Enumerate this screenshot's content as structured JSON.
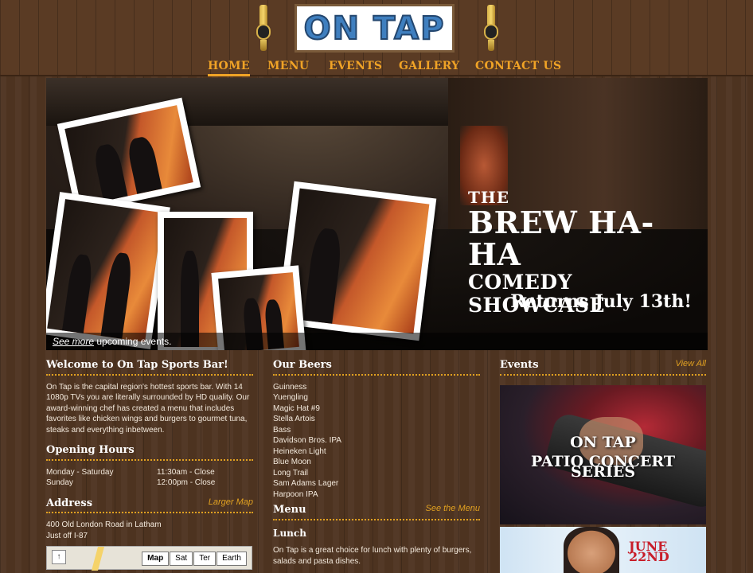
{
  "logo": {
    "text": "ON TAP"
  },
  "nav": {
    "items": [
      {
        "label": "HOME",
        "active": true
      },
      {
        "label": "MENU",
        "active": false
      },
      {
        "label": "EVENTS",
        "active": false
      },
      {
        "label": "GALLERY",
        "active": false
      },
      {
        "label": "CONTACT US",
        "active": false
      }
    ]
  },
  "hero": {
    "line1": "THE",
    "line2": "BREW HA-HA",
    "line3": "COMEDY SHOWCASE",
    "returns": "Returns July 13th!",
    "caption_link": "See more",
    "caption_rest": " upcoming events."
  },
  "welcome": {
    "title": "Welcome to On Tap Sports Bar!",
    "body": "On Tap is the capital region's hottest sports bar. With 14 1080p TVs you are literally surrounded by HD quality. Our award-winning chef has created a menu that includes favorites like chicken wings and burgers to gourmet tuna, steaks and everything inbetween."
  },
  "hours": {
    "title": "Opening Hours",
    "rows": [
      {
        "day": "Monday - Saturday",
        "time": "11:30am - Close"
      },
      {
        "day": "Sunday",
        "time": "12:00pm - Close"
      }
    ]
  },
  "address": {
    "title": "Address",
    "link": "Larger Map",
    "line1": "400 Old London Road in Latham",
    "line2": "Just off I-87",
    "map_buttons": [
      "Map",
      "Sat",
      "Ter",
      "Earth"
    ]
  },
  "beers": {
    "title": "Our Beers",
    "items": [
      "Guinness",
      "Yuengling",
      "Magic Hat #9",
      "Stella Artois",
      "Bass",
      "Davidson Bros. IPA",
      "Heineken Light",
      "Blue Moon",
      "Long Trail",
      "Sam Adams Lager",
      "Harpoon IPA"
    ]
  },
  "menu": {
    "title": "Menu",
    "link": "See the Menu",
    "lunch_title": "Lunch",
    "lunch_body": "On Tap is a great choice for lunch with plenty of burgers, salads and pasta dishes."
  },
  "events": {
    "title": "Events",
    "link": "View All",
    "event1_line1": "ON TAP",
    "event1_line2": "PATIO CONCERT SERIES",
    "event2_date": "JUNE 22ND"
  },
  "colors": {
    "accent": "#f0a326",
    "link": "#e0a020",
    "background": "#4d3320"
  }
}
